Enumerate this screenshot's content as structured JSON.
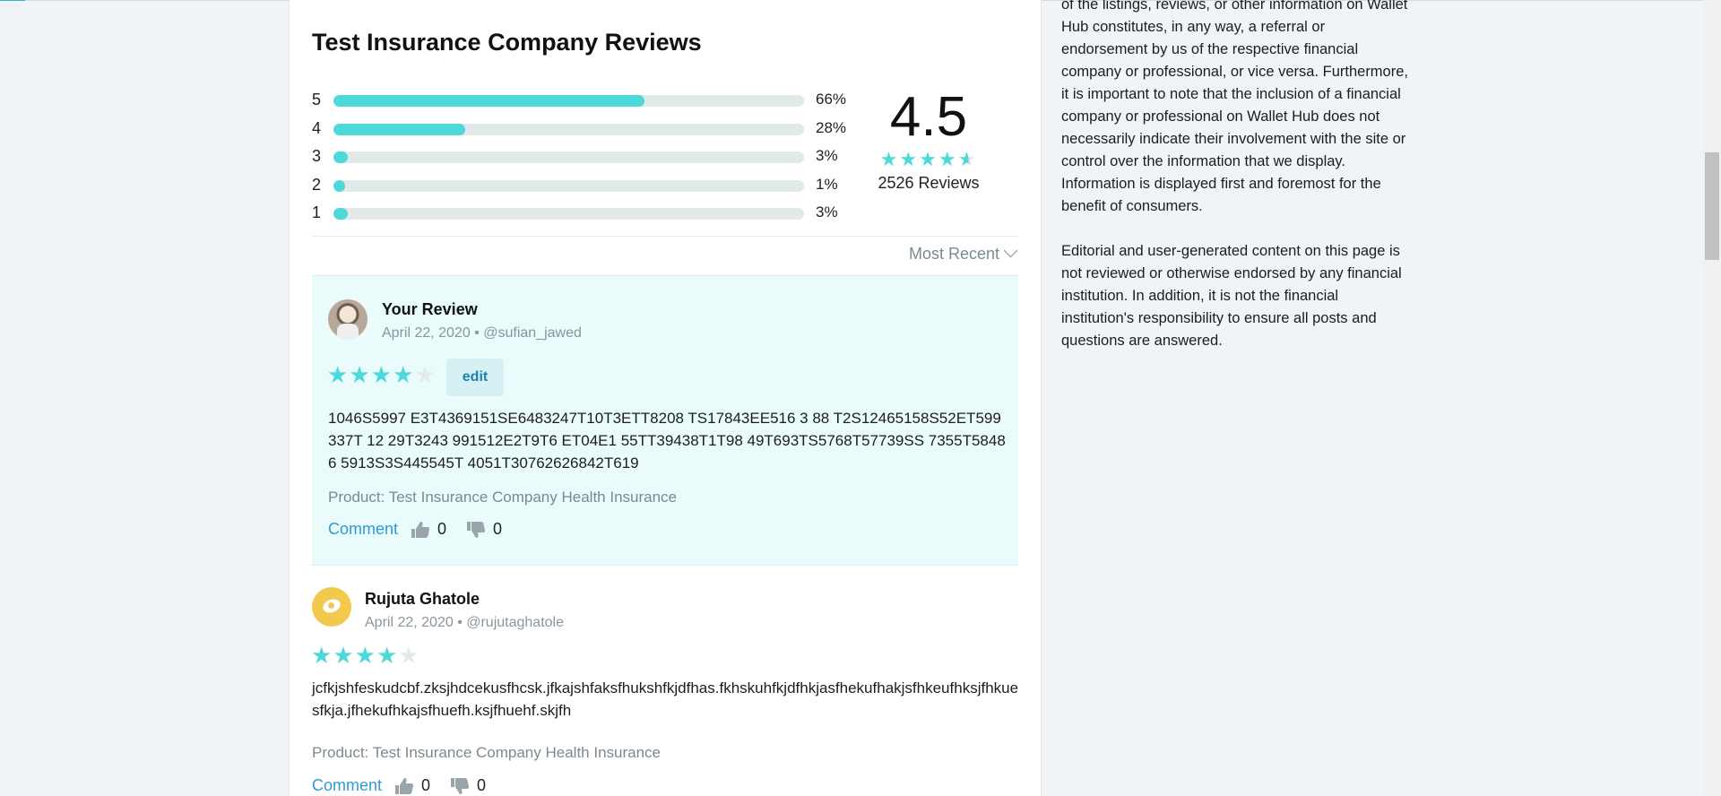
{
  "header": {
    "title": "Test Insurance Company Reviews"
  },
  "rating_summary": {
    "bars": [
      {
        "stars": "5",
        "percent_label": "66%",
        "fraction": 0.66
      },
      {
        "stars": "4",
        "percent_label": "28%",
        "fraction": 0.28
      },
      {
        "stars": "3",
        "percent_label": "3%",
        "fraction": 0.03
      },
      {
        "stars": "2",
        "percent_label": "1%",
        "fraction": 0.01
      },
      {
        "stars": "1",
        "percent_label": "3%",
        "fraction": 0.03
      }
    ],
    "score": "4.5",
    "stars_value": 4.5,
    "review_count_label": "2526 Reviews"
  },
  "sort": {
    "label": "Most Recent"
  },
  "your_review": {
    "label": "Your Review",
    "date": "April 22, 2020",
    "handle": "• @sufian_jawed",
    "stars_value": 4,
    "edit_label": "edit",
    "body": "1046S5997 E3T4369151SE6483247T10T3ETT8208 TS17843EE516 3 88 T2S12465158S52ET599 337T 12 29T3243 991512E2T9T6 ET04E1 55TT39438T1T98 49T693TS5768T57739SS 7355T58486 5913S3S445545T 4051T30762626842T619",
    "product": "Product: Test Insurance Company Health Insurance",
    "comment_label": "Comment",
    "likes": "0",
    "dislikes": "0"
  },
  "reviews": [
    {
      "name": "Rujuta Ghatole",
      "date": "April 22, 2020",
      "handle": "• @rujutaghatole",
      "stars_value": 4,
      "body": "jcfkjshfeskudcbf.zksjhdcekusfhcsk.jfkajshfaksfhukshfkjdfhas.fkhskuhfkjdfhkjasfhekufhakjsfhkeufhksjfhkuesfkja.jfhekufhkajsfhuefh.ksjfhuehf.skjfh",
      "product": "Product: Test Insurance Company Health Insurance",
      "comment_label": "Comment",
      "likes": "0",
      "dislikes": "0"
    }
  ],
  "sidebar": {
    "paragraph1": "of the listings, reviews, or other information on Wallet Hub constitutes, in any way, a referral or endorsement by us of the respective financial company or professional, or vice versa. Furthermore, it is important to note that the inclusion of a financial company or professional on Wallet Hub does not necessarily indicate their involvement with the site or control over the information that we display. Information is displayed first and foremost for the benefit of consumers.",
    "paragraph2": "Editorial and user-generated content on this page is not reviewed or otherwise endorsed by any financial institution. In addition, it is not the financial institution's responsibility to ensure all posts and questions are answered."
  },
  "colors": {
    "accent": "#4dd8da",
    "link": "#2f9bd6",
    "review_bg": "#e9fbfb"
  }
}
